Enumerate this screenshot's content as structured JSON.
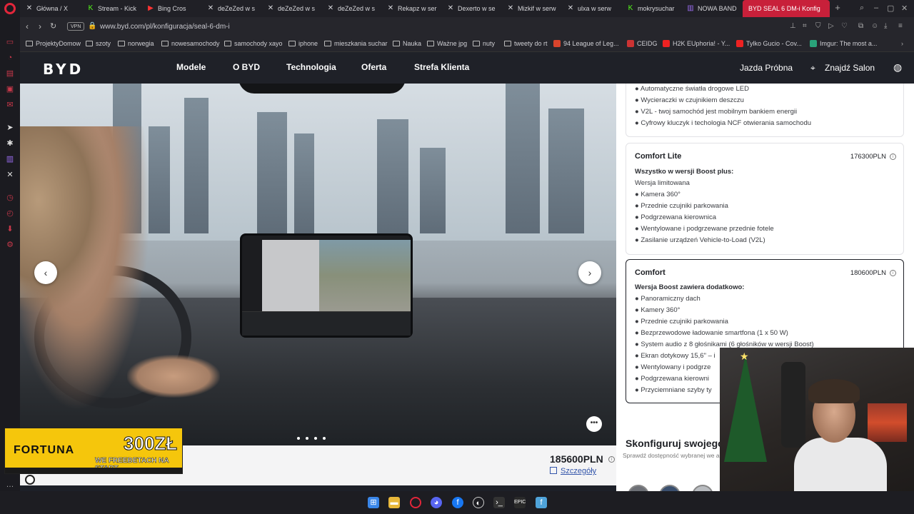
{
  "browser": {
    "tabs": [
      {
        "label": "Główna / X",
        "icon": "x-icon"
      },
      {
        "label": "Stream - Kick",
        "icon": "kick-icon"
      },
      {
        "label": "Bing Cros",
        "icon": "youtube-icon"
      },
      {
        "label": "deZeZed w s",
        "icon": "x-icon"
      },
      {
        "label": "deZeZed w s",
        "icon": "x-icon"
      },
      {
        "label": "deZeZed w s",
        "icon": "x-icon"
      },
      {
        "label": "Rekapz w ser",
        "icon": "x-icon"
      },
      {
        "label": "Dexerto w se",
        "icon": "x-icon"
      },
      {
        "label": "Mizkif w serw",
        "icon": "x-icon"
      },
      {
        "label": "ulxa w serw",
        "icon": "x-icon"
      },
      {
        "label": "mokrysuchar",
        "icon": "kick-icon"
      },
      {
        "label": "NOWA BAND",
        "icon": "twitch-icon"
      },
      {
        "label": "BYD SEAL 6 DM-i Konfig",
        "icon": "byd-icon"
      }
    ],
    "vpn_label": "VPN",
    "url": "www.byd.com/pl/konfiguracja/seal-6-dm-i",
    "bookmarks": [
      "ProjektyDomow",
      "szoty",
      "norwegia",
      "nowesamochody",
      "samochody xayo",
      "iphone",
      "mieszkania suchar",
      "Nauka",
      "Ważne jpg",
      "nuty",
      "tweety do rt",
      "94 League of Leg...",
      "CEIDG",
      "H2K EUphoria! - Y...",
      "Tylko Gucio - Cov...",
      "Imgur: The most a..."
    ]
  },
  "site": {
    "logo": "BYD",
    "nav": [
      "Modele",
      "O BYD",
      "Technologia",
      "Oferta",
      "Strefa Klienta"
    ],
    "test_drive": "Jazda Próbna",
    "find_salon": "Znajdź Salon"
  },
  "price_bar": {
    "price": "185600PLN",
    "details": "Szczegóły"
  },
  "panel": {
    "top_features": [
      "● Automatyczne światła drogowe LED",
      "● Wycieraczki w czujnikiem deszczu",
      "● V2L - twoj samochód jest mobilnym bankiem energii",
      "● Cyfrowy kluczyk i techologia NCF otwierania samochodu"
    ],
    "comfort_lite": {
      "title": "Comfort Lite",
      "price": "176300PLN",
      "heading": "Wszystko w wersji Boost plus:",
      "features": [
        "Wersja limitowana",
        "● Kamera 360°",
        "● Przednie czujniki parkowania",
        "● Podgrzewana kierownica",
        "● Wentylowane i podgrzewane przednie fotele",
        "● Zasilanie urządzeń Vehicle-to-Load (V2L)"
      ]
    },
    "comfort": {
      "title": "Comfort",
      "price": "180600PLN",
      "heading": "Wersja Boost zawiera dodatkowo:",
      "features": [
        "● Panoramiczny dach",
        "● Kamery 360°",
        "● Przednie czujniki parkowania",
        "● Bezprzewodowe ładowanie smartfona (1 x 50 W)",
        "● System audio z 8 głośnikami (6 głośników w wersji Boost)",
        "● Ekran dotykowy 15,6\" – i",
        "● Wentylowany i podgrze",
        "● Podgrzewana kierowni",
        "● Przyciemniane szyby ty"
      ]
    },
    "configure_title": "Skonfiguruj swojego",
    "configure_sub": "Sprawdź dostępność wybranej we autoryzowanego Dealera BYD."
  },
  "ad": {
    "brand": "FORTUNA",
    "amount": "300ZŁ",
    "sub": "WE FREEBETACH NA START"
  }
}
